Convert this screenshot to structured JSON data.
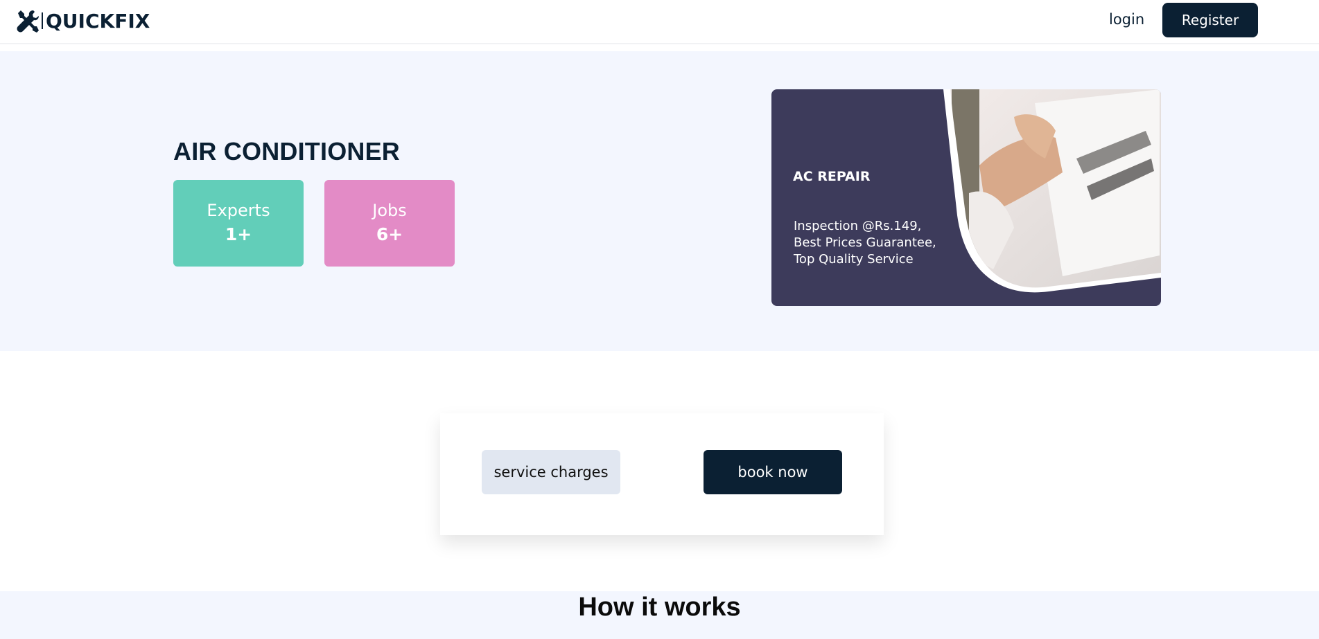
{
  "brand": {
    "name": "QUICKFIX",
    "icon": "wrench-screwdriver-icon"
  },
  "nav": {
    "login": "login",
    "register": "Register"
  },
  "hero": {
    "title": "AIR CONDITIONER",
    "stats": [
      {
        "label": "Experts",
        "value": "1+",
        "color": "#62ceb9"
      },
      {
        "label": "Jobs",
        "value": "6+",
        "color": "#e38bc6"
      }
    ],
    "banner": {
      "title": "AC REPAIR",
      "lines": [
        "Inspection @Rs.149,",
        "Best Prices Guarantee,",
        "Top Quality Service"
      ],
      "background": "#3d3b5b"
    }
  },
  "actions": {
    "charges": "service charges",
    "book": "book now"
  },
  "how": {
    "title": "How it works"
  },
  "colors": {
    "primary": "#0b2033",
    "hero_bg": "#f3f6fe"
  }
}
